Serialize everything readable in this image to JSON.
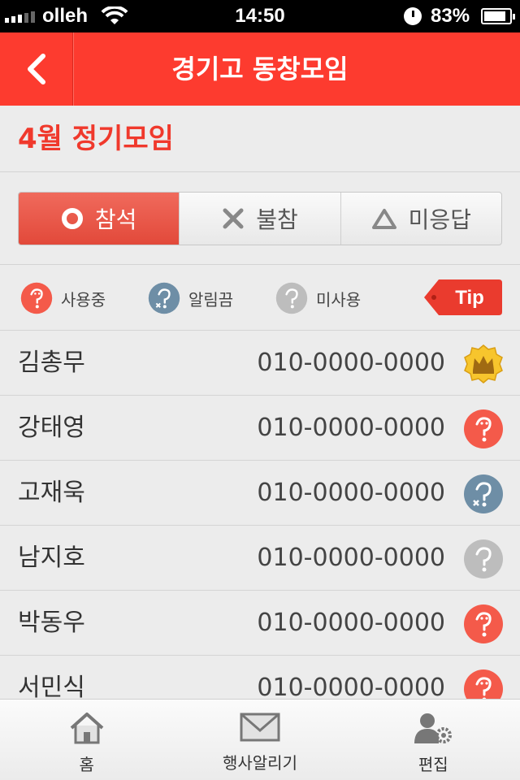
{
  "status_bar": {
    "carrier": "olleh",
    "time": "14:50",
    "battery": "83%"
  },
  "header": {
    "title": "경기고 동창모임",
    "back_icon": "chevron-left-icon"
  },
  "event": {
    "title": "4월 정기모임"
  },
  "attendance": {
    "options": [
      {
        "label": "참석",
        "icon": "circle-icon",
        "selected": true
      },
      {
        "label": "불참",
        "icon": "x-icon",
        "selected": false
      },
      {
        "label": "미응답",
        "icon": "triangle-icon",
        "selected": false
      }
    ]
  },
  "legend": {
    "items": [
      {
        "label": "사용중",
        "icon": "face-active-icon",
        "color": "#f45a4a"
      },
      {
        "label": "알림끔",
        "icon": "face-muted-icon",
        "color": "#6e8ea6"
      },
      {
        "label": "미사용",
        "icon": "face-unused-icon",
        "color": "#bdbdbd"
      }
    ],
    "tip_label": "Tip"
  },
  "members": [
    {
      "name": "김총무",
      "phone": "010-0000-0000",
      "status": "admin-crown"
    },
    {
      "name": "강태영",
      "phone": "010-0000-0000",
      "status": "active"
    },
    {
      "name": "고재욱",
      "phone": "010-0000-0000",
      "status": "muted"
    },
    {
      "name": "남지호",
      "phone": "010-0000-0000",
      "status": "unused"
    },
    {
      "name": "박동우",
      "phone": "010-0000-0000",
      "status": "active"
    },
    {
      "name": "서민식",
      "phone": "010-0000-0000",
      "status": "active"
    }
  ],
  "tabbar": {
    "tabs": [
      {
        "label": "홈",
        "icon": "home-icon"
      },
      {
        "label": "행사알리기",
        "icon": "envelope-icon"
      },
      {
        "label": "편집",
        "icon": "user-settings-icon"
      }
    ]
  },
  "colors": {
    "brand": "#fd3b2f",
    "accent_text": "#f0392c"
  }
}
